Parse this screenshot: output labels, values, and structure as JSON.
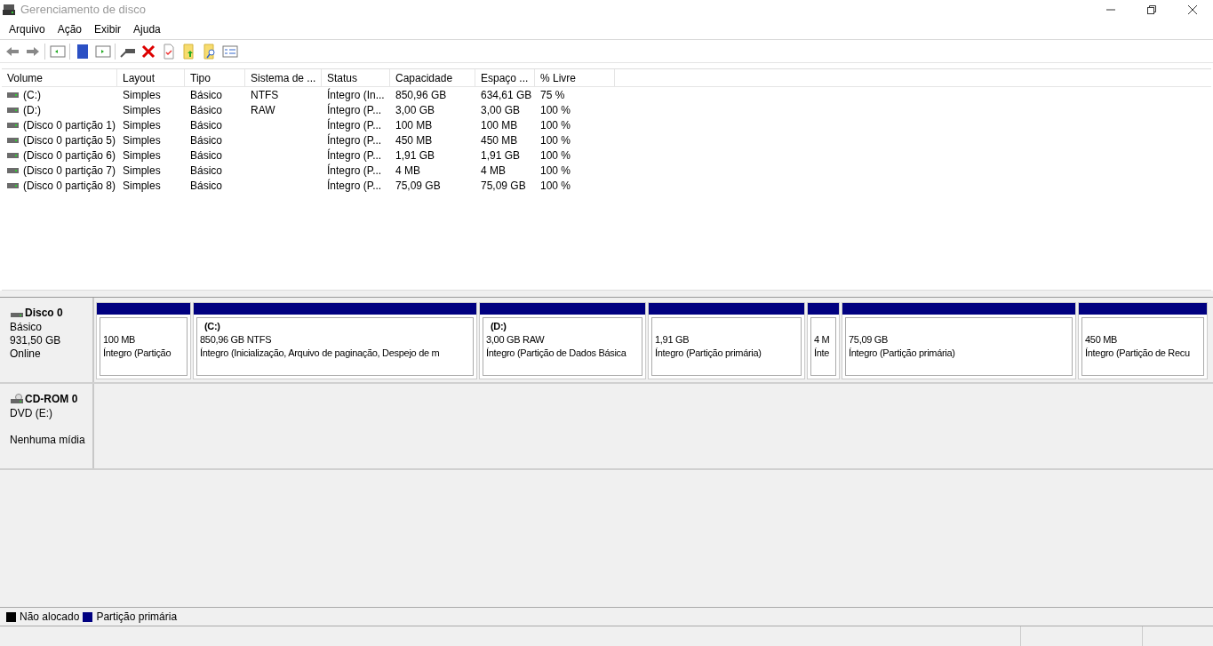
{
  "window": {
    "title": "Gerenciamento de disco"
  },
  "menu": [
    "Arquivo",
    "Ação",
    "Exibir",
    "Ajuda"
  ],
  "table": {
    "columns": [
      "Volume",
      "Layout",
      "Tipo",
      "Sistema de ...",
      "Status",
      "Capacidade",
      "Espaço ...",
      "% Livre"
    ],
    "rows": [
      [
        "(C:)",
        "Simples",
        "Básico",
        "NTFS",
        "Íntegro (In...",
        "850,96 GB",
        "634,61 GB",
        "75 %"
      ],
      [
        "(D:)",
        "Simples",
        "Básico",
        "RAW",
        "Íntegro (P...",
        "3,00 GB",
        "3,00 GB",
        "100 %"
      ],
      [
        "(Disco 0 partição 1)",
        "Simples",
        "Básico",
        "",
        "Íntegro (P...",
        "100 MB",
        "100 MB",
        "100 %"
      ],
      [
        "(Disco 0 partição 5)",
        "Simples",
        "Básico",
        "",
        "Íntegro (P...",
        "450 MB",
        "450 MB",
        "100 %"
      ],
      [
        "(Disco 0 partição 6)",
        "Simples",
        "Básico",
        "",
        "Íntegro (P...",
        "1,91 GB",
        "1,91 GB",
        "100 %"
      ],
      [
        "(Disco 0 partição 7)",
        "Simples",
        "Básico",
        "",
        "Íntegro (P...",
        "4 MB",
        "4 MB",
        "100 %"
      ],
      [
        "(Disco 0 partição 8)",
        "Simples",
        "Básico",
        "",
        "Íntegro (P...",
        "75,09 GB",
        "75,09 GB",
        "100 %"
      ]
    ]
  },
  "disks": [
    {
      "kind": "disk",
      "name": "Disco 0",
      "lines": [
        "Básico",
        "931,50 GB",
        "Online"
      ],
      "partitions": [
        {
          "size": "100 MB",
          "status": "Íntegro (Partição"
        },
        {
          "label": "(C:)",
          "size": "850,96 GB NTFS",
          "status": "Íntegro (Inicialização, Arquivo de paginação, Despejo de m"
        },
        {
          "label": "(D:)",
          "size": "3,00 GB RAW",
          "status": "Íntegro (Partição de Dados Básica"
        },
        {
          "size": "1,91 GB",
          "status": "Íntegro (Partição primária)"
        },
        {
          "size": "4 M",
          "status": "Ínte"
        },
        {
          "size": "75,09 GB",
          "status": "Íntegro (Partição primária)"
        },
        {
          "size": "450 MB",
          "status": "Íntegro (Partição de Recu"
        }
      ]
    },
    {
      "kind": "cdrom",
      "name": "CD-ROM 0",
      "lines": [
        "DVD (E:)",
        "Nenhuma mídia"
      ]
    }
  ],
  "legend": [
    {
      "label": "Não alocado",
      "color": "#000000"
    },
    {
      "label": "Partição primária",
      "color": "#000080"
    }
  ]
}
